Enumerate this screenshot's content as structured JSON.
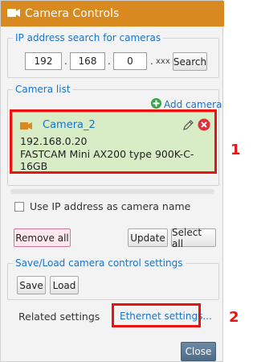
{
  "window": {
    "title": "Camera Controls"
  },
  "ip_search": {
    "legend": "IP address search for cameras",
    "octet1": "192",
    "octet2": "168",
    "octet3": "0",
    "octet4": "xxx",
    "dot": ".",
    "search_label": "Search"
  },
  "camera_list": {
    "legend": "Camera list",
    "add_label": "Add camera",
    "camera": {
      "name": "Camera_2",
      "ip": "192.168.0.20",
      "model_line1": "FASTCAM Mini AX200 type 900K-C-",
      "model_line2": "16GB"
    }
  },
  "options": {
    "use_ip_label": "Use IP address as camera name",
    "remove_all_label": "Remove all",
    "update_label": "Update",
    "select_all_label": "Select all"
  },
  "save_load": {
    "legend": "Save/Load camera control settings",
    "save_label": "Save",
    "load_label": "Load"
  },
  "related": {
    "label": "Related settings",
    "ethernet_label": "Ethernet settings..."
  },
  "footer": {
    "close_label": "Close"
  },
  "callouts": {
    "one": "1",
    "two": "2"
  },
  "colors": {
    "titlebar": "#d88a21",
    "accent_blue": "#1a73c8",
    "card_green": "#d8ecc5",
    "highlight_red": "#e81414"
  }
}
